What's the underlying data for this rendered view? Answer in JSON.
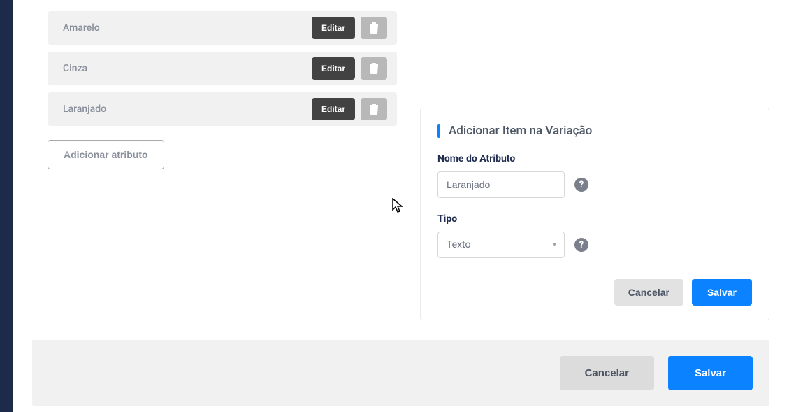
{
  "attributes": [
    {
      "label": "Amarelo"
    },
    {
      "label": "Cinza"
    },
    {
      "label": "Laranjado"
    }
  ],
  "edit_label": "Editar",
  "add_attr_label": "Adicionar atributo",
  "panel": {
    "title": "Adicionar Item na Variação",
    "name_label": "Nome do Atributo",
    "name_value": "Laranjado",
    "type_label": "Tipo",
    "type_value": "Texto",
    "cancel_label": "Cancelar",
    "save_label": "Salvar"
  },
  "footer": {
    "cancel_label": "Cancelar",
    "save_label": "Salvar"
  },
  "help_glyph": "?"
}
